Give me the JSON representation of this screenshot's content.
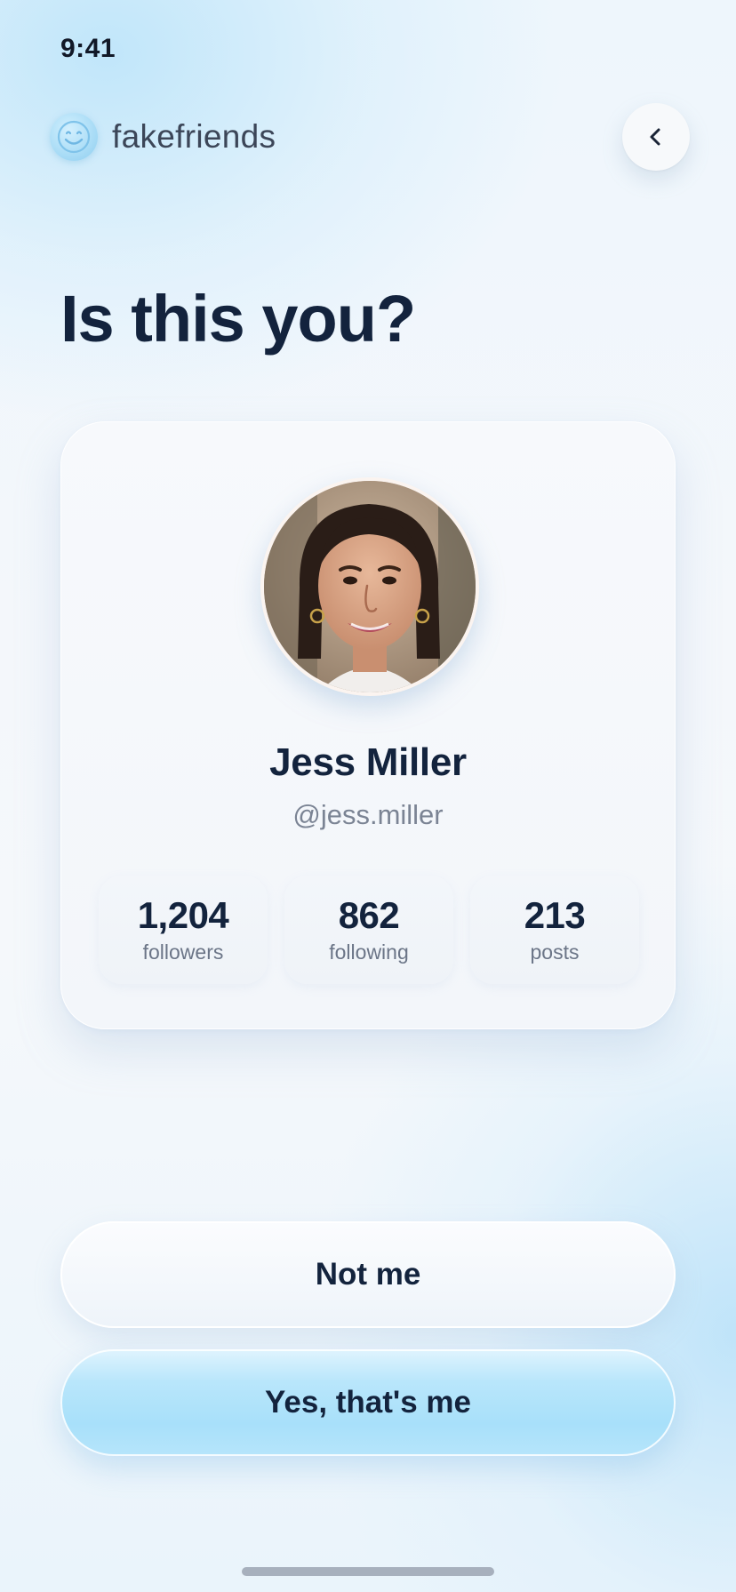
{
  "status_bar": {
    "time": "9:41"
  },
  "header": {
    "brand_name": "fakefriends",
    "logo_icon": "smiley-face-icon",
    "back_icon": "chevron-left-icon"
  },
  "title": "Is this you?",
  "profile": {
    "name": "Jess Miller",
    "handle": "@jess.miller",
    "stats": [
      {
        "value": "1,204",
        "label": "followers"
      },
      {
        "value": "862",
        "label": "following"
      },
      {
        "value": "213",
        "label": "posts"
      }
    ]
  },
  "actions": {
    "secondary_label": "Not me",
    "primary_label": "Yes, that's me"
  },
  "colors": {
    "text_primary": "#13233d",
    "text_secondary": "#7b8494",
    "accent": "#a8e0fa"
  }
}
